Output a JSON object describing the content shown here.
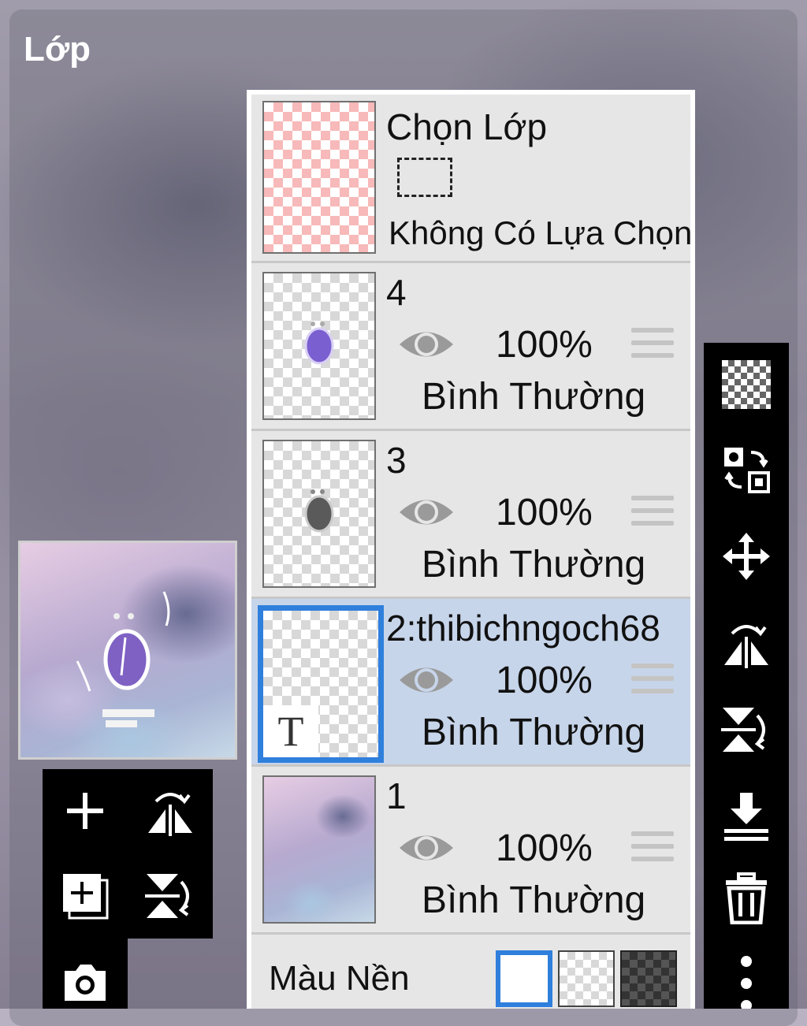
{
  "header": {
    "title": "Lớp"
  },
  "selection_row": {
    "title": "Chọn Lớp",
    "status": "Không Có Lựa Chọn"
  },
  "layers": [
    {
      "name": "4",
      "opacity": "100%",
      "blend": "Bình Thường",
      "visible": true,
      "selected": false
    },
    {
      "name": "3",
      "opacity": "100%",
      "blend": "Bình Thường",
      "visible": true,
      "selected": false
    },
    {
      "name": "2:thibichngoch68",
      "opacity": "100%",
      "blend": "Bình Thường",
      "visible": true,
      "selected": true
    },
    {
      "name": "1",
      "opacity": "100%",
      "blend": "Bình Thường",
      "visible": true,
      "selected": false
    }
  ],
  "background_color": {
    "label": "Màu Nền",
    "options": [
      "white",
      "transparent",
      "dark-checker"
    ],
    "selected": "white"
  },
  "thumbnail_text": {
    "text_layer_glyph": "T"
  },
  "right_toolbar": [
    "transparency-icon",
    "swap-layers-icon",
    "move-icon",
    "flip-horizontal-icon",
    "flip-vertical-icon",
    "merge-down-icon",
    "trash-icon",
    "more-icon"
  ],
  "left_toolbar": [
    "add-layer-icon",
    "flip-horizontal-icon",
    "add-layer-copy-icon",
    "flip-vertical-icon",
    "camera-icon"
  ],
  "colors": {
    "accent": "#2f7fdc",
    "selected_row": "#c7d5ea",
    "panel": "#e6e6e6",
    "pink_checker": "#f7b9b9"
  }
}
